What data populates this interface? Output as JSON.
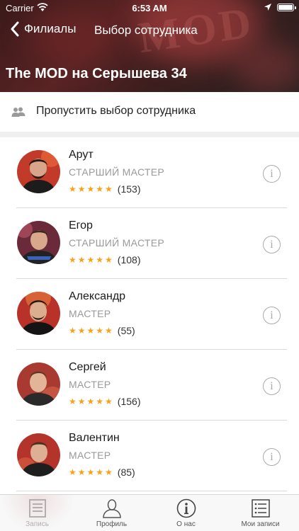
{
  "status_bar": {
    "carrier": "Carrier",
    "time": "6:53 AM"
  },
  "nav": {
    "back_label": "Филиалы",
    "title": "Выбор сотрудника"
  },
  "header": {
    "branch_name": "The MOD на Серышева 34",
    "neon_text": "MOD"
  },
  "skip": {
    "label": "Пропустить выбор сотрудника"
  },
  "staff": [
    {
      "name": "Арут",
      "role": "СТАРШИЙ МАСТЕР",
      "stars": "★★★★★",
      "reviews": "(153)",
      "rating": 5
    },
    {
      "name": "Егор",
      "role": "СТАРШИЙ МАСТЕР",
      "stars": "★★★★★",
      "reviews": "(108)",
      "rating": 5
    },
    {
      "name": "Александр",
      "role": "МАСТЕР",
      "stars": "★★★★★",
      "reviews": "(55)",
      "rating": 5
    },
    {
      "name": "Сергей",
      "role": "МАСТЕР",
      "stars": "★★★★★",
      "reviews": "(156)",
      "rating": 5
    },
    {
      "name": "Валентин",
      "role": "МАСТЕР",
      "stars": "★★★★★",
      "reviews": "(85)",
      "rating": 5
    }
  ],
  "info_glyph": "i",
  "tabs": [
    {
      "label": "Запись",
      "icon": "document-list-icon",
      "active": true
    },
    {
      "label": "Профиль",
      "icon": "person-icon",
      "active": false
    },
    {
      "label": "О нас",
      "icon": "info-circle-icon",
      "active": false
    },
    {
      "label": "Мои записи",
      "icon": "checklist-icon",
      "active": false
    }
  ],
  "colors": {
    "star": "#f6a31b",
    "header_bg": "#4a2222",
    "tab_active": "#b0b0b0"
  }
}
